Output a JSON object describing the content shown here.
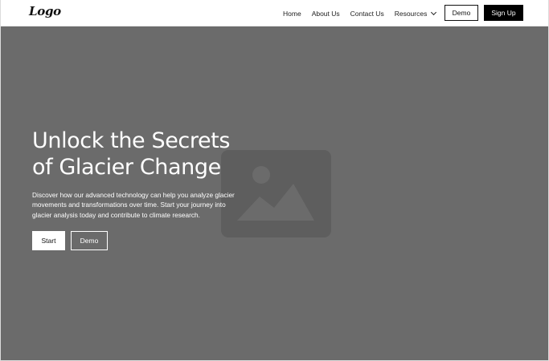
{
  "navbar": {
    "logo_text": "Logo",
    "links": [
      "Home",
      "About Us",
      "Contact Us"
    ],
    "resources_label": "Resources",
    "demo_label": "Demo",
    "signup_label": "Sign Up"
  },
  "hero": {
    "title_line1": "Unlock the Secrets",
    "title_line2": "of Glacier Change",
    "description": "Discover how our advanced technology can help you analyze glacier movements and transformations over time. Start your journey into glacier analysis today and contribute to climate research.",
    "start_label": "Start",
    "demo_label": "Demo",
    "background_color": "#6b6b6b",
    "placeholder_icon": "image-placeholder-icon"
  }
}
